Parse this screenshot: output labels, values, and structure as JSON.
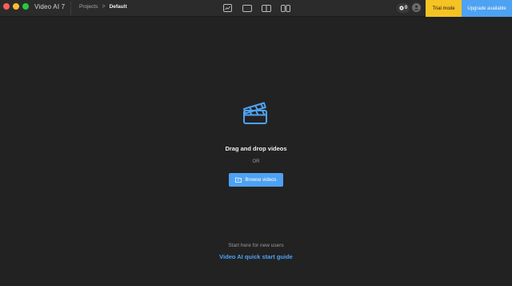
{
  "window": {
    "app_title": "Video AI 7",
    "traffic_lights": {
      "close": "#fd5f57",
      "minimize": "#febc2e",
      "maximize": "#28c840"
    }
  },
  "breadcrumb": {
    "parent": "Projects",
    "current": "Default"
  },
  "toolbar": {
    "view_icons": [
      "single-view-icon",
      "preview-view-icon",
      "side-by-side-view-icon",
      "split-view-icon"
    ],
    "credits_count": "0",
    "trial_label": "Trial mode",
    "upgrade_label": "Upgrade available"
  },
  "main": {
    "drop_label": "Drag and drop videos",
    "or_label": "OR",
    "browse_label": "Browse videos",
    "hint_label": "Start here for new users",
    "guide_link": "Video AI quick start guide"
  },
  "colors": {
    "accent": "#4ea2f2",
    "trial": "#f6c324",
    "background": "#222223",
    "titlebar": "#2b2b2c"
  }
}
